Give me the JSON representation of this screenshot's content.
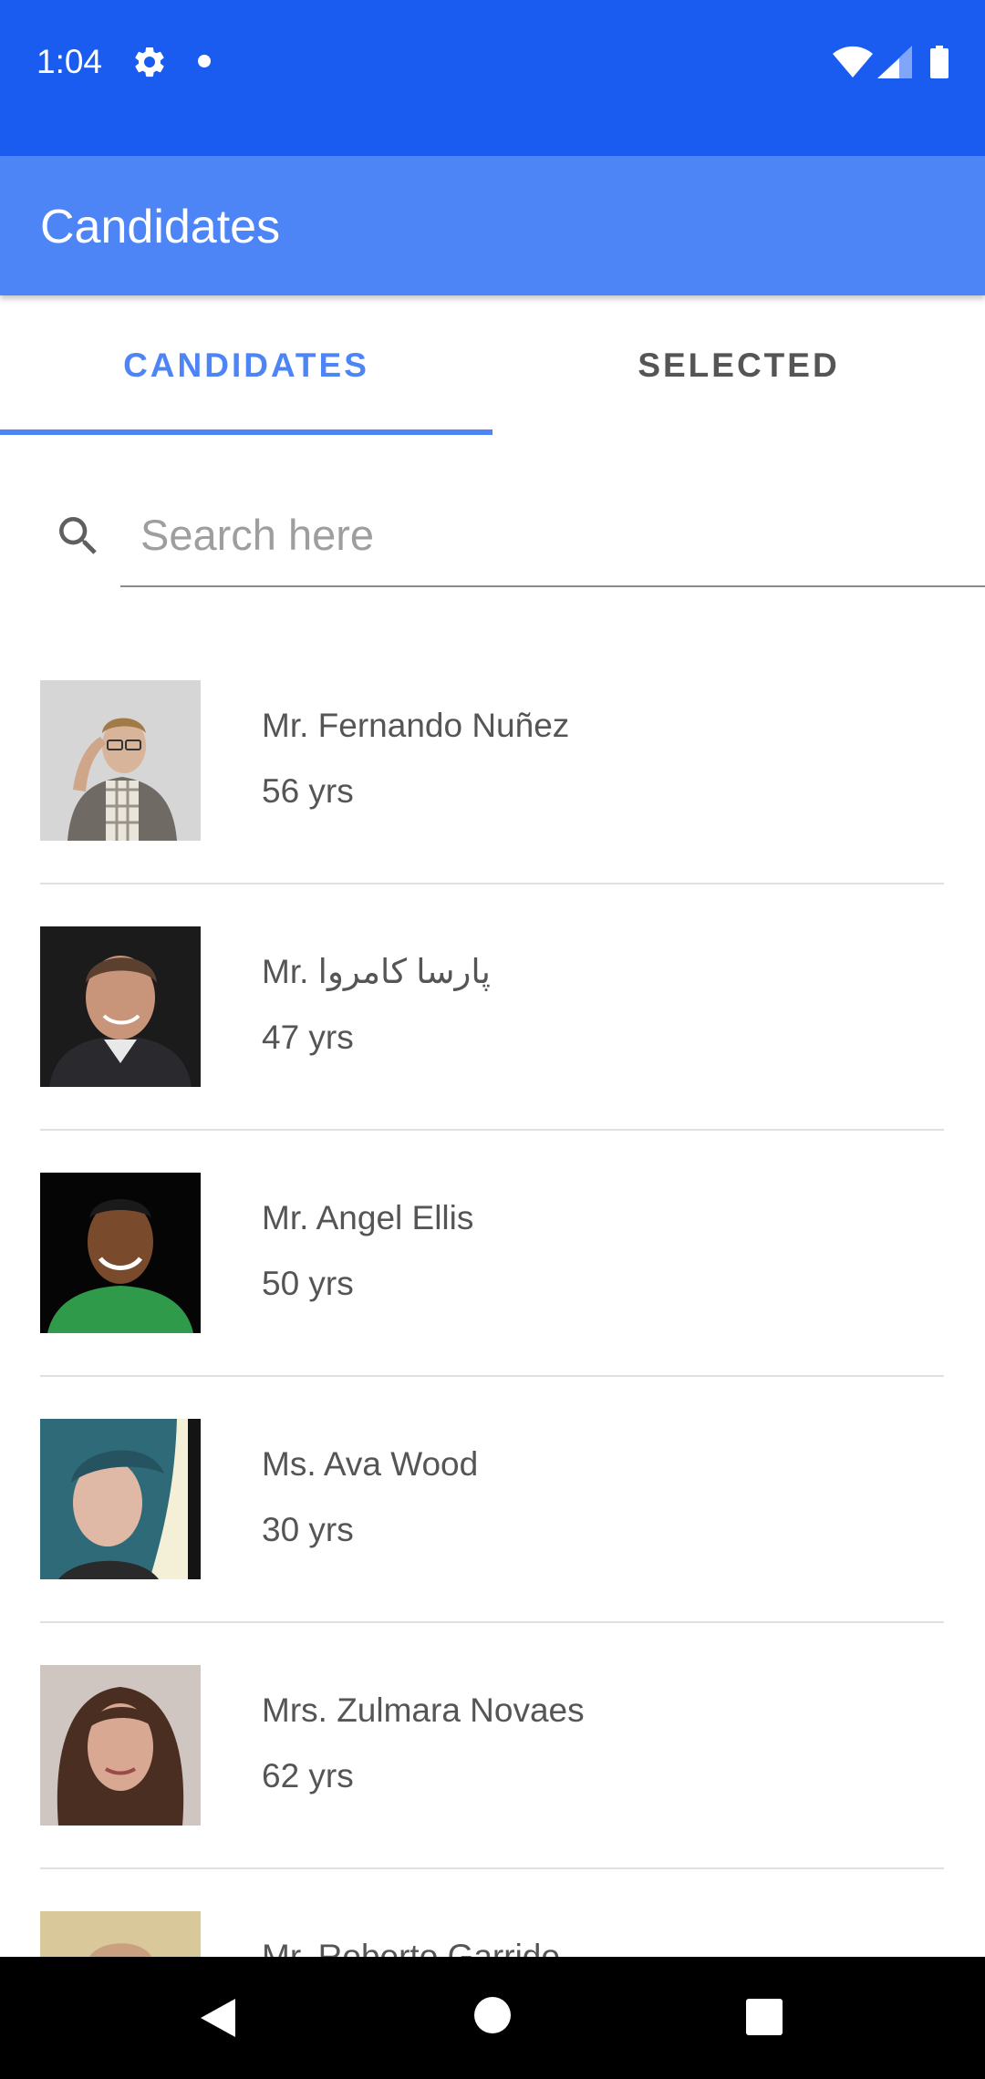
{
  "status_bar": {
    "time": "1:04",
    "icons": [
      "gear-icon",
      "notification-dot-icon",
      "wifi-icon",
      "signal-icon",
      "battery-icon"
    ]
  },
  "app_bar": {
    "title": "Candidates"
  },
  "tabs": [
    {
      "label": "CANDIDATES",
      "active": true
    },
    {
      "label": "SELECTED",
      "active": false
    }
  ],
  "search": {
    "placeholder": "Search here",
    "value": ""
  },
  "candidates": [
    {
      "name": "Mr. Fernando Nuñez",
      "age": "56 yrs"
    },
    {
      "name": "Mr. پارسا کامروا",
      "age": "47 yrs"
    },
    {
      "name": "Mr. Angel Ellis",
      "age": "50 yrs"
    },
    {
      "name": "Ms. Ava Wood",
      "age": "30 yrs"
    },
    {
      "name": "Mrs. Zulmara Novaes",
      "age": "62 yrs"
    },
    {
      "name": "Mr. Roberto Garrido",
      "age": ""
    }
  ],
  "colors": {
    "status_bar": "#1a5cf0",
    "app_bar": "#4d84f6",
    "accent": "#4d84f6",
    "text": "#555555"
  }
}
